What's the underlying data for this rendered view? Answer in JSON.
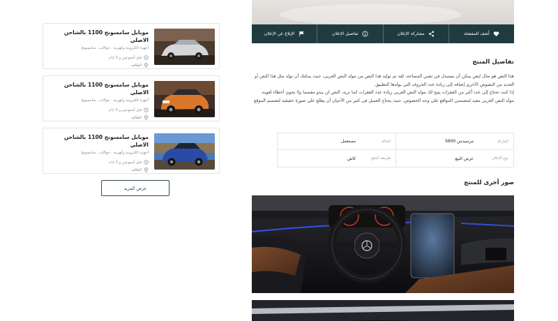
{
  "action_bar": {
    "favorite": "أضف للمفضلة",
    "share": "مشاركة الإعلان",
    "details": "تفاصيل الإعلان",
    "report": "الإبلاغ عن الإعلان"
  },
  "product_details": {
    "title": "تفاصيل المنتج",
    "paragraph_1": "هذا النص هو مثال لنص يمكن أن يستبدل في نفس المساحة، لقد تم توليد هذا النص من مولد النص العربى، حيث يمكنك أن تولد مثل هذا النص أو العديد من النصوص الأخرى إضافة إلى زيادة عدد الحروف التى يولدها التطبيق.",
    "paragraph_2": "إذا كنت تحتاج إلى عدد أكبر من الفقرات يتيح لك مولد النص العربى زيادة عدد الفقرات كما تريد، النص لن يبدو مقسما ولا يحوي أخطاء لغوية، مولد النص العربى مفيد لمصممي المواقع على وجه الخصوص، حيث يحتاج العميل فى كثير من الأحيان أن يطلع على صورة حقيقية لتصميم الموقع"
  },
  "specs": [
    {
      "key": "الماركة",
      "value": "مرسيدس S600"
    },
    {
      "key": "الحالة",
      "value": "مستعمل"
    },
    {
      "key": "نوع الإعلان",
      "value": "عرض البيع"
    },
    {
      "key": "طريقة الدفع",
      "value": "كاش"
    }
  ],
  "more_photos": {
    "title": "صور أخرى للمنتج"
  },
  "listings": [
    {
      "title": "موبايل سامسونج 1100 بالشاحن الاصلي",
      "category": "أجهزة الكترونية وكهربية . جوالات . سامسونج",
      "time": "قبل أسبوعين و 3 ايام",
      "location": "الطائف"
    },
    {
      "title": "موبايل سامسونج 1100 بالشاحن الاصلي",
      "category": "أجهزة الكترونية وكهربية . جوالات . سامسونج",
      "time": "قبل أسبوعين و 3 ايام",
      "location": "الطائف"
    },
    {
      "title": "موبايل سامسونج 1100 بالشاحن الاصلي",
      "category": "أجهزة الكترونية وكهربية . جوالات . سامسونج",
      "time": "قبل أسبوعين و 3 ايام",
      "location": "الطائف"
    }
  ],
  "more_button": "عرض المزيد",
  "colors": {
    "primary": "#1f3b40",
    "border": "#e3e3e3",
    "text_muted": "#8a8a8a"
  },
  "icons": {
    "favorite": "heart-icon",
    "share": "share-icon",
    "details": "info-icon",
    "report": "flag-icon",
    "time": "clock-icon",
    "location": "location-pin-icon"
  }
}
